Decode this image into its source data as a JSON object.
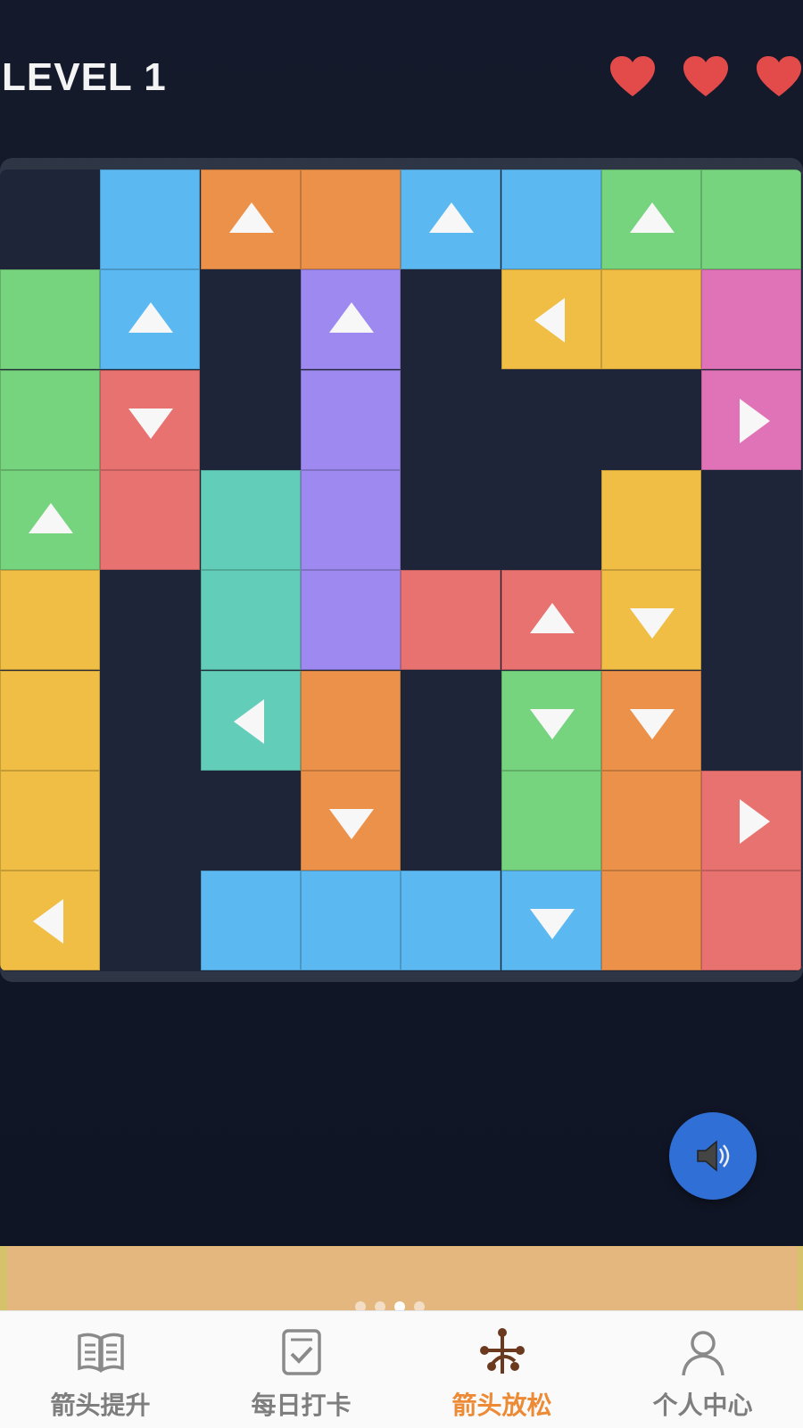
{
  "header": {
    "level_label": "LEVEL 1",
    "lives": 3,
    "heart_color": "#e34b4b"
  },
  "board": {
    "rows": 8,
    "cols": 8,
    "palette": {
      "blue": "#5bb8f0",
      "orange": "#ec914a",
      "green": "#77d47e",
      "purple": "#9d89f0",
      "yellow": "#f0bd45",
      "pink": "#e073b8",
      "red": "#e8726f",
      "teal": "#62cdb8"
    },
    "cells": [
      [
        null,
        "blue",
        "orange:up",
        "orange",
        "blue:up",
        "blue",
        "green:up",
        "green"
      ],
      [
        "green",
        "blue:up",
        null,
        "purple:up",
        null,
        "yellow:left",
        "yellow",
        "pink"
      ],
      [
        "green",
        "red:down",
        null,
        "purple",
        null,
        null,
        null,
        "pink:right"
      ],
      [
        "green:up",
        "red",
        "teal",
        "purple",
        null,
        null,
        "yellow",
        null
      ],
      [
        "yellow",
        null,
        "teal",
        "purple",
        "red",
        "red:up",
        "yellow:down",
        null
      ],
      [
        "yellow",
        null,
        "teal:left",
        "orange",
        null,
        "green:down",
        "orange:down",
        null
      ],
      [
        "yellow",
        null,
        null,
        "orange:down",
        null,
        "green",
        "orange",
        "red:right"
      ],
      [
        "yellow:left",
        null,
        "blue",
        "blue",
        "blue",
        "blue:down",
        "orange",
        "red"
      ]
    ]
  },
  "sound_button": {
    "icon": "speaker-icon",
    "color": "#2f6fd6"
  },
  "banner": {
    "color": "#e4b77f",
    "pages": 4,
    "active_page": 3
  },
  "tabs": [
    {
      "label": "箭头提升",
      "icon": "book-icon",
      "active": false
    },
    {
      "label": "每日打卡",
      "icon": "checkin-icon",
      "active": false
    },
    {
      "label": "箭头放松",
      "icon": "nodes-icon",
      "active": true
    },
    {
      "label": "个人中心",
      "icon": "person-icon",
      "active": false
    }
  ]
}
